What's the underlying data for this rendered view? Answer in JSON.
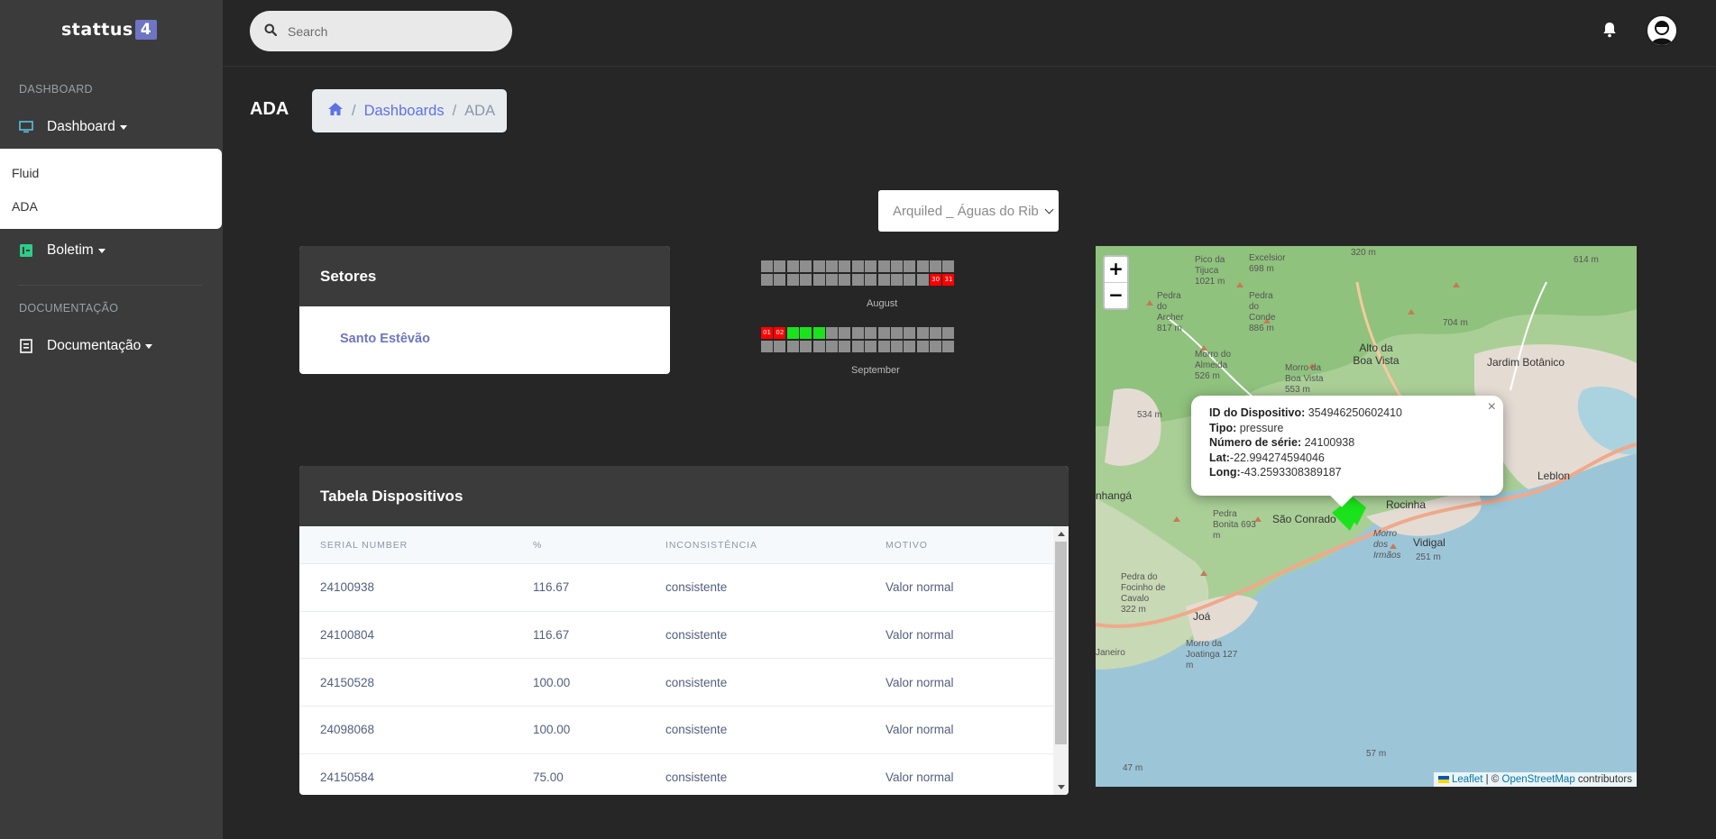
{
  "brand": {
    "name": "stattus",
    "badge": "4"
  },
  "sidebar": {
    "heading_dashboard": "DASHBOARD",
    "dashboard_label": "Dashboard",
    "dropdown_items": [
      "Fluid",
      "ADA"
    ],
    "boletim_label": "Boletim",
    "heading_docs": "DOCUMENTAÇÃO",
    "docs_label": "Documentação"
  },
  "topbar": {
    "search_placeholder": "Search"
  },
  "header": {
    "title": "ADA",
    "breadcrumb": {
      "link": "Dashboards",
      "separator": "/",
      "active": "ADA"
    }
  },
  "select": {
    "value": "Arquiled _ Águas do Rib"
  },
  "setores": {
    "title": "Setores",
    "items": [
      "Santo Estêvão"
    ]
  },
  "calendar": {
    "months": [
      {
        "label": "August",
        "cells": [
          "",
          "",
          "",
          "",
          "",
          "",
          "",
          "",
          "",
          "",
          "",
          "",
          "",
          "",
          "",
          "",
          "",
          "",
          "",
          "",
          "",
          "",
          "",
          "",
          "",
          "",
          "",
          "",
          "30",
          "31"
        ],
        "status": [
          "gray",
          "gray",
          "gray",
          "gray",
          "gray",
          "gray",
          "gray",
          "gray",
          "gray",
          "gray",
          "gray",
          "gray",
          "gray",
          "gray",
          "gray",
          "gray",
          "gray",
          "gray",
          "gray",
          "gray",
          "gray",
          "gray",
          "gray",
          "gray",
          "gray",
          "gray",
          "gray",
          "gray",
          "red",
          "red"
        ],
        "lead": 0,
        "trail_empty_first_row": 0
      },
      {
        "label": "September",
        "cells": [
          "01",
          "02",
          "",
          "",
          "",
          "",
          "",
          "",
          "",
          "",
          "",
          "",
          "",
          "",
          "",
          "",
          "",
          "",
          "",
          "",
          "",
          "",
          "",
          "",
          "",
          "",
          "",
          "",
          "",
          ""
        ],
        "status": [
          "red",
          "red",
          "green",
          "green",
          "green",
          "gray",
          "gray",
          "gray",
          "gray",
          "gray",
          "gray",
          "gray",
          "gray",
          "gray",
          "gray",
          "gray",
          "gray",
          "gray",
          "gray",
          "gray",
          "gray",
          "gray",
          "gray",
          "gray",
          "gray",
          "gray",
          "gray",
          "gray",
          "gray",
          "gray"
        ]
      }
    ]
  },
  "map": {
    "zoom_in": "+",
    "zoom_out": "−",
    "popup": {
      "close": "×",
      "fields": [
        {
          "label": "ID do Dispositivo:",
          "value": " 354946250602410"
        },
        {
          "label": "Tipo:",
          "value": " pressure"
        },
        {
          "label": "Número de série:",
          "value": " 24100938"
        },
        {
          "label": "Lat:",
          "value": "-22.994274594046"
        },
        {
          "label": "Long:",
          "value": "-43.2593308389187"
        }
      ]
    },
    "attribution": {
      "leaflet": "Leaflet",
      "sep": " | © ",
      "osm": "OpenStreetMap",
      "suffix": " contributors"
    },
    "labels": [
      "Alto da Boa Vista",
      "Jardim Botânico",
      "Rocinha",
      "Vidigal",
      "São Conrado",
      "Leblon",
      "Pedra Bonita 693 m",
      "Morro dos Irmãos",
      "Joá",
      "Morro da Joatinga 127 m",
      "57 m",
      "47 m",
      "251 m",
      "704 m",
      "320 m",
      "614 m",
      "Pico da Tijuca 1021 m",
      "Excelsior 698 m",
      "Pedra do Conde 886 m",
      "Pedra do Archer 817 m",
      "Morro do Almeida 526 m",
      "534 m",
      "Morro da Boa Vista 553 m",
      "Pedra do Focinho de Cavalo 322 m",
      "Janeiro",
      "nhangá"
    ]
  },
  "table": {
    "title": "Tabela Dispositivos",
    "columns": [
      "SERIAL NUMBER",
      "%",
      "INCONSISTÊNCIA",
      "MOTIVO"
    ],
    "rows": [
      [
        "24100938",
        "116.67",
        "consistente",
        "Valor normal"
      ],
      [
        "24100804",
        "116.67",
        "consistente",
        "Valor normal"
      ],
      [
        "24150528",
        "100.00",
        "consistente",
        "Valor normal"
      ],
      [
        "24098068",
        "100.00",
        "consistente",
        "Valor normal"
      ],
      [
        "24150584",
        "75.00",
        "consistente",
        "Valor normal"
      ]
    ]
  },
  "colors": {
    "accent": "#6e75c4",
    "link": "#5e72e4",
    "red": "#ff0000",
    "green": "#1be31b"
  }
}
